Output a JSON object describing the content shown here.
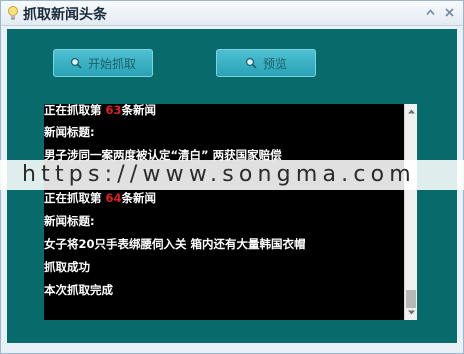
{
  "window": {
    "title": "抓取新闻头条"
  },
  "toolbar": {
    "start_label": "开始抓取",
    "preview_label": "预览"
  },
  "console": {
    "lines_top": [
      {
        "prefix": "正在抓取第 ",
        "number": "63",
        "suffix": "条新闻"
      },
      {
        "text": "新闻标题:"
      },
      {
        "text": "男子涉同一案两度被认定“清白” 两获国家赔偿"
      }
    ],
    "lines_bottom": [
      {
        "prefix": "正在抓取第 ",
        "number": "64",
        "suffix": "条新闻"
      },
      {
        "text": "新闻标题:"
      },
      {
        "text": "女子将20只手表绑腰伺入关 箱内还有大量韩国衣帽"
      },
      {
        "text": "抓取成功"
      },
      {
        "text": "本次抓取完成"
      }
    ]
  },
  "watermark": {
    "text": "https://www.songma.com"
  },
  "colors": {
    "panel": "#076b6b",
    "button": "#38b2c4",
    "highlight": "#e02020"
  }
}
